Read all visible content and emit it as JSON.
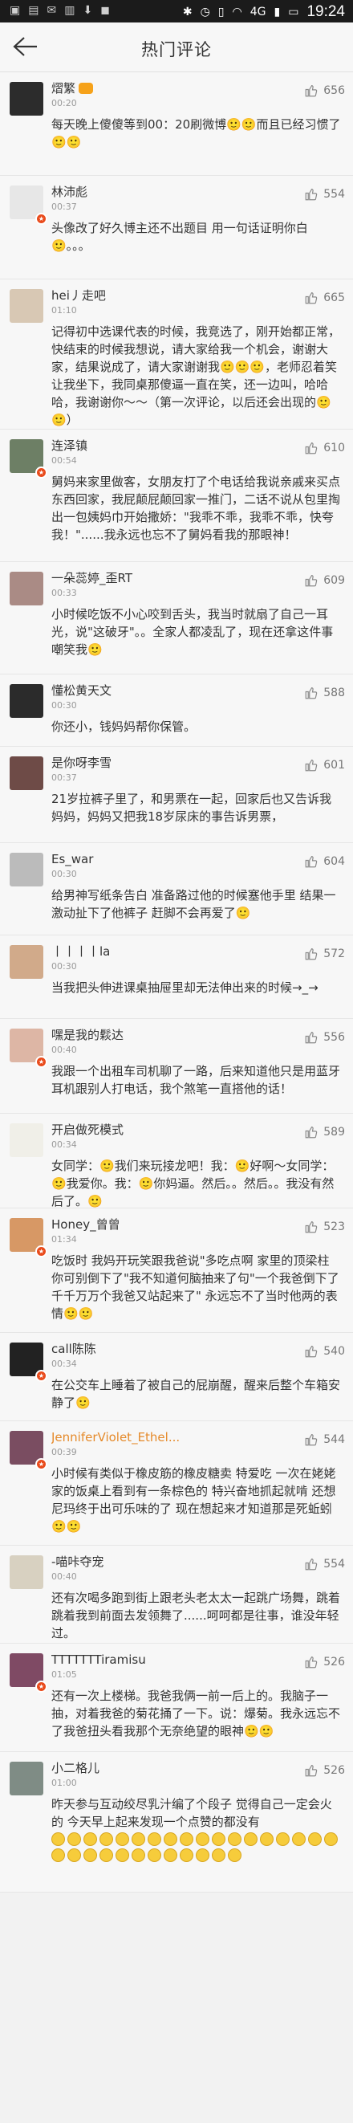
{
  "status": {
    "left_icons": [
      "notification-icon",
      "image-icon",
      "message-icon",
      "bars-icon",
      "download-icon",
      "bag-icon"
    ],
    "right_text": "4G",
    "time": "19:24"
  },
  "nav": {
    "title": "热门评论"
  },
  "comments": [
    {
      "name": "熠繁",
      "time": "00:20",
      "likes": "656",
      "text": "每天晚上傻傻等到00：20刷微博🙂🙂而且已经习惯了🙂🙂",
      "badge": true
    },
    {
      "name": "林沛彪",
      "time": "00:37",
      "likes": "554",
      "text": "头像改了好久博主还不出题目 用一句话证明你白🙂。。。",
      "badge": false
    },
    {
      "name": "hei丿走吧",
      "time": "01:10",
      "likes": "665",
      "text": "记得初中选课代表的时候，我竞选了，刚开始都正常，快结束的时候我想说，请大家给我一个机会，谢谢大家，结果说成了，请大家谢谢我🙂🙂🙂，老师忍着笑让我坐下，我同桌那傻逼一直在笑，还一边叫，哈哈哈，我谢谢你～～（第一次评论，以后还会出现的🙂🙂）",
      "badge": false
    },
    {
      "name": "连泽镇",
      "time": "00:54",
      "likes": "610",
      "text": "舅妈来家里做客，女朋友打了个电话给我说亲戚来买点东西回家，我屁颠屁颠回家一推门，二话不说从包里掏出一包姨妈巾开始撒娇：\"我乖不乖，我乖不乖，快夸我！\"......我永远也忘不了舅妈看我的那眼神！",
      "badge": false
    },
    {
      "name": "一朵蕊婷_歪RT",
      "time": "00:33",
      "likes": "609",
      "text": "小时候吃饭不小心咬到舌头，我当时就扇了自己一耳光，说\"这破牙\"。。全家人都凌乱了，现在还拿这件事嘲笑我🙂",
      "badge": false
    },
    {
      "name": "懂松黄天文",
      "time": "00:30",
      "likes": "588",
      "text": "你还小，钱妈妈帮你保管。",
      "badge": false
    },
    {
      "name": "是你呀李雪",
      "time": "00:37",
      "likes": "601",
      "text": "21岁拉裤子里了，和男票在一起，回家后也又告诉我妈妈，妈妈又把我18岁尿床的事告诉男票，",
      "badge": false
    },
    {
      "name": "Es_war",
      "time": "00:30",
      "likes": "604",
      "text": "给男神写纸条告白 准备路过他的时候塞他手里 结果一激动扯下了他裤子 赶脚不会再爱了🙂",
      "badge": false
    },
    {
      "name": "丨丨丨丨la",
      "time": "00:30",
      "likes": "572",
      "text": "当我把头伸进课桌抽屉里却无法伸出来的时候→_→",
      "badge": false
    },
    {
      "name": "嘿是我的鬏达",
      "time": "00:40",
      "likes": "556",
      "text": "我跟一个出租车司机聊了一路，后来知道他只是用蓝牙耳机跟别人打电话，我个煞笔一直搭他的话！",
      "badge": false
    },
    {
      "name": "开启做死模式",
      "time": "00:34",
      "likes": "589",
      "text": "女同学：🙂我们来玩接龙吧！我：🙂好啊～女同学：🙂我爱你。我：🙂你妈逼。然后。。然后。。我没有然后了。🙂",
      "badge": false
    },
    {
      "name": "Honey_曾曾",
      "time": "01:34",
      "likes": "523",
      "text": "吃饭时 我妈开玩笑跟我爸说\"多吃点啊 家里的顶梁柱 你可别倒下了\"我不知道何脑抽来了句\"一个我爸倒下了 千千万万个我爸又站起来了\" 永远忘不了当时他两的表情🙂🙂",
      "badge": false
    },
    {
      "name": "call陈陈",
      "time": "00:34",
      "likes": "540",
      "text": "在公交车上睡着了被自己的屁崩醒，醒来后整个车箱安静了🙂",
      "badge": false
    },
    {
      "name": "JenniferViolet_Ethel...",
      "time": "00:39",
      "likes": "544",
      "text": "小时候有类似于橡皮筋的橡皮糖卖 特爱吃 一次在姥姥家的饭桌上看到有一条棕色的 特兴奋地抓起就啃 还想 尼玛终于出可乐味的了 现在想起来才知道那是死蚯蚓🙂🙂",
      "badge": false,
      "orange": true
    },
    {
      "name": "-喵咔夺宠",
      "time": "00:40",
      "likes": "554",
      "text": "还有次喝多跑到街上跟老头老太太一起跳广场舞，跳着跳着我到前面去发领舞了......呵呵都是往事，谁没年轻过。",
      "badge": false
    },
    {
      "name": "TTTTTTTiramisu",
      "time": "01:05",
      "likes": "526",
      "text": "还有一次上楼梯。我爸我俩一前一后上的。我脑子一抽，对着我爸的菊花捅了一下。说：爆菊。我永远忘不了我爸扭头看我那个无奈绝望的眼神🙂🙂",
      "badge": false
    },
    {
      "name": "小二格儿",
      "time": "01:00",
      "likes": "526",
      "text": "昨天参与互动绞尽乳汁编了个段子 觉得自己一定会火的 今天早上起来发现一个点赞的都没有",
      "badge": false
    }
  ]
}
